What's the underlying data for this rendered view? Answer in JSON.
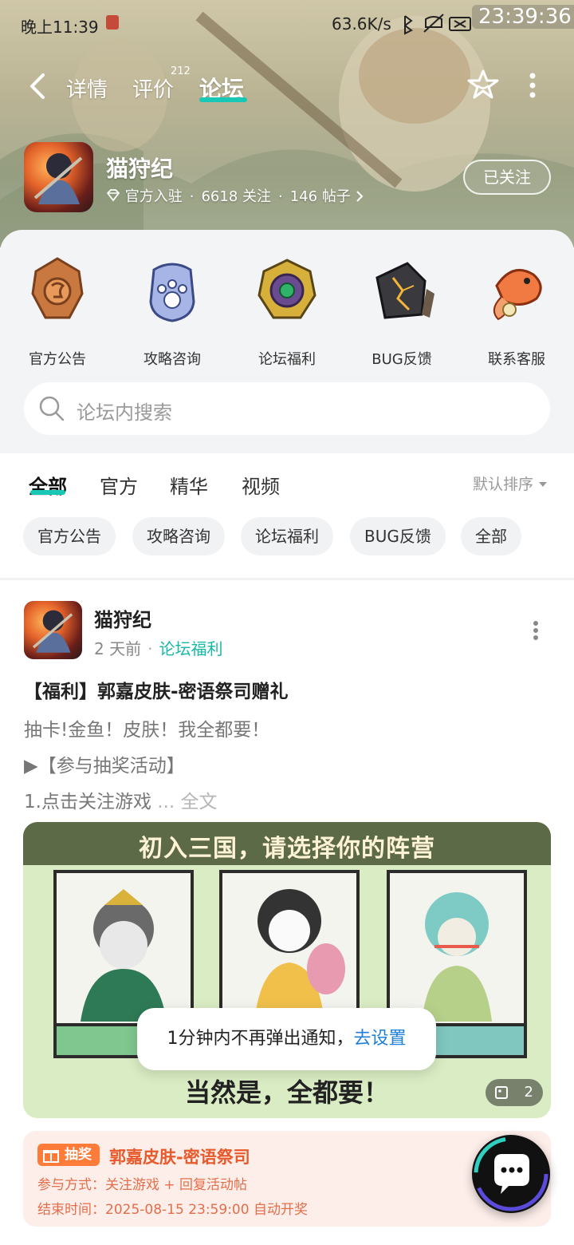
{
  "status_bar": {
    "time": "晚上11:39",
    "net_speed": "63.6K/s",
    "clock": "23:39:36"
  },
  "nav": {
    "tab_detail": "详情",
    "tab_review": "评价",
    "review_count": "212",
    "tab_forum": "论坛"
  },
  "game": {
    "name": "猫狩纪",
    "official": "官方入驻",
    "followers": "6618 关注",
    "posts": "146 帖子",
    "follow_label": "已关注"
  },
  "categories": [
    {
      "label": "官方公告"
    },
    {
      "label": "攻略咨询"
    },
    {
      "label": "论坛福利"
    },
    {
      "label": "BUG反馈"
    },
    {
      "label": "联系客服"
    }
  ],
  "search": {
    "placeholder": "论坛内搜索"
  },
  "filter_tabs": [
    "全部",
    "官方",
    "精华",
    "视频"
  ],
  "sort_label": "默认排序",
  "chips": [
    "官方公告",
    "攻略咨询",
    "论坛福利",
    "BUG反馈",
    "全部"
  ],
  "post": {
    "author": "猫狩纪",
    "time": "2 天前",
    "category": "论坛福利",
    "title": "【福利】郭嘉皮肤-密语祭司赠礼",
    "line1": "抽卡!金鱼！皮肤！我全都要！",
    "line2": "▶【参与抽奖活动】",
    "line3": "1.点击关注游戏",
    "more": " ... 全文",
    "image_banner": "初入三国，请选择你的阵营",
    "image_bottom": "当然是，全都要！",
    "image_count": "2"
  },
  "toast": {
    "text": "1分钟内不再弹出通知，",
    "link": "去设置"
  },
  "lottery": {
    "badge": "抽奖",
    "title": "郭嘉皮肤-密语祭司",
    "method": "参与方式：关注游戏 + 回复活动帖",
    "end": "结束时间：2025-08-15 23:59:00 自动开奖"
  }
}
